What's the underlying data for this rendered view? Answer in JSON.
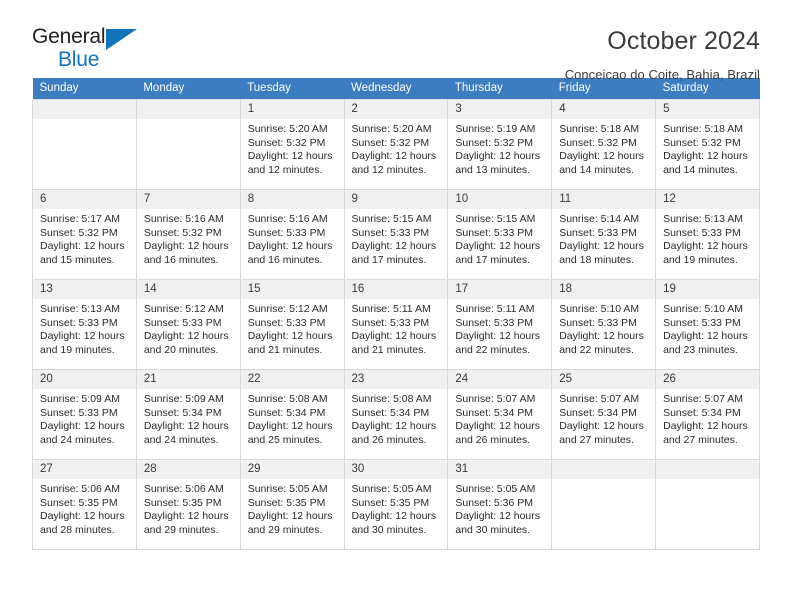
{
  "logo": {
    "word_top": "General",
    "word_bottom": "Blue",
    "accent_color": "#1173ba",
    "triangle_icon": "triangle-icon"
  },
  "header": {
    "title": "October 2024",
    "subtitle": "Conceicao do Coite, Bahia, Brazil"
  },
  "theme": {
    "header_row_bg": "#3b7dc0",
    "daynum_bg": "#f0f0f0",
    "grid_border": "#d8d8d8"
  },
  "calendar": {
    "weekday_headers": [
      "Sunday",
      "Monday",
      "Tuesday",
      "Wednesday",
      "Thursday",
      "Friday",
      "Saturday"
    ],
    "weeks": [
      [
        {
          "day": "",
          "lines": []
        },
        {
          "day": "",
          "lines": []
        },
        {
          "day": "1",
          "lines": [
            "Sunrise: 5:20 AM",
            "Sunset: 5:32 PM",
            "Daylight: 12 hours",
            "and 12 minutes."
          ]
        },
        {
          "day": "2",
          "lines": [
            "Sunrise: 5:20 AM",
            "Sunset: 5:32 PM",
            "Daylight: 12 hours",
            "and 12 minutes."
          ]
        },
        {
          "day": "3",
          "lines": [
            "Sunrise: 5:19 AM",
            "Sunset: 5:32 PM",
            "Daylight: 12 hours",
            "and 13 minutes."
          ]
        },
        {
          "day": "4",
          "lines": [
            "Sunrise: 5:18 AM",
            "Sunset: 5:32 PM",
            "Daylight: 12 hours",
            "and 14 minutes."
          ]
        },
        {
          "day": "5",
          "lines": [
            "Sunrise: 5:18 AM",
            "Sunset: 5:32 PM",
            "Daylight: 12 hours",
            "and 14 minutes."
          ]
        }
      ],
      [
        {
          "day": "6",
          "lines": [
            "Sunrise: 5:17 AM",
            "Sunset: 5:32 PM",
            "Daylight: 12 hours",
            "and 15 minutes."
          ]
        },
        {
          "day": "7",
          "lines": [
            "Sunrise: 5:16 AM",
            "Sunset: 5:32 PM",
            "Daylight: 12 hours",
            "and 16 minutes."
          ]
        },
        {
          "day": "8",
          "lines": [
            "Sunrise: 5:16 AM",
            "Sunset: 5:33 PM",
            "Daylight: 12 hours",
            "and 16 minutes."
          ]
        },
        {
          "day": "9",
          "lines": [
            "Sunrise: 5:15 AM",
            "Sunset: 5:33 PM",
            "Daylight: 12 hours",
            "and 17 minutes."
          ]
        },
        {
          "day": "10",
          "lines": [
            "Sunrise: 5:15 AM",
            "Sunset: 5:33 PM",
            "Daylight: 12 hours",
            "and 17 minutes."
          ]
        },
        {
          "day": "11",
          "lines": [
            "Sunrise: 5:14 AM",
            "Sunset: 5:33 PM",
            "Daylight: 12 hours",
            "and 18 minutes."
          ]
        },
        {
          "day": "12",
          "lines": [
            "Sunrise: 5:13 AM",
            "Sunset: 5:33 PM",
            "Daylight: 12 hours",
            "and 19 minutes."
          ]
        }
      ],
      [
        {
          "day": "13",
          "lines": [
            "Sunrise: 5:13 AM",
            "Sunset: 5:33 PM",
            "Daylight: 12 hours",
            "and 19 minutes."
          ]
        },
        {
          "day": "14",
          "lines": [
            "Sunrise: 5:12 AM",
            "Sunset: 5:33 PM",
            "Daylight: 12 hours",
            "and 20 minutes."
          ]
        },
        {
          "day": "15",
          "lines": [
            "Sunrise: 5:12 AM",
            "Sunset: 5:33 PM",
            "Daylight: 12 hours",
            "and 21 minutes."
          ]
        },
        {
          "day": "16",
          "lines": [
            "Sunrise: 5:11 AM",
            "Sunset: 5:33 PM",
            "Daylight: 12 hours",
            "and 21 minutes."
          ]
        },
        {
          "day": "17",
          "lines": [
            "Sunrise: 5:11 AM",
            "Sunset: 5:33 PM",
            "Daylight: 12 hours",
            "and 22 minutes."
          ]
        },
        {
          "day": "18",
          "lines": [
            "Sunrise: 5:10 AM",
            "Sunset: 5:33 PM",
            "Daylight: 12 hours",
            "and 22 minutes."
          ]
        },
        {
          "day": "19",
          "lines": [
            "Sunrise: 5:10 AM",
            "Sunset: 5:33 PM",
            "Daylight: 12 hours",
            "and 23 minutes."
          ]
        }
      ],
      [
        {
          "day": "20",
          "lines": [
            "Sunrise: 5:09 AM",
            "Sunset: 5:33 PM",
            "Daylight: 12 hours",
            "and 24 minutes."
          ]
        },
        {
          "day": "21",
          "lines": [
            "Sunrise: 5:09 AM",
            "Sunset: 5:34 PM",
            "Daylight: 12 hours",
            "and 24 minutes."
          ]
        },
        {
          "day": "22",
          "lines": [
            "Sunrise: 5:08 AM",
            "Sunset: 5:34 PM",
            "Daylight: 12 hours",
            "and 25 minutes."
          ]
        },
        {
          "day": "23",
          "lines": [
            "Sunrise: 5:08 AM",
            "Sunset: 5:34 PM",
            "Daylight: 12 hours",
            "and 26 minutes."
          ]
        },
        {
          "day": "24",
          "lines": [
            "Sunrise: 5:07 AM",
            "Sunset: 5:34 PM",
            "Daylight: 12 hours",
            "and 26 minutes."
          ]
        },
        {
          "day": "25",
          "lines": [
            "Sunrise: 5:07 AM",
            "Sunset: 5:34 PM",
            "Daylight: 12 hours",
            "and 27 minutes."
          ]
        },
        {
          "day": "26",
          "lines": [
            "Sunrise: 5:07 AM",
            "Sunset: 5:34 PM",
            "Daylight: 12 hours",
            "and 27 minutes."
          ]
        }
      ],
      [
        {
          "day": "27",
          "lines": [
            "Sunrise: 5:06 AM",
            "Sunset: 5:35 PM",
            "Daylight: 12 hours",
            "and 28 minutes."
          ]
        },
        {
          "day": "28",
          "lines": [
            "Sunrise: 5:06 AM",
            "Sunset: 5:35 PM",
            "Daylight: 12 hours",
            "and 29 minutes."
          ]
        },
        {
          "day": "29",
          "lines": [
            "Sunrise: 5:05 AM",
            "Sunset: 5:35 PM",
            "Daylight: 12 hours",
            "and 29 minutes."
          ]
        },
        {
          "day": "30",
          "lines": [
            "Sunrise: 5:05 AM",
            "Sunset: 5:35 PM",
            "Daylight: 12 hours",
            "and 30 minutes."
          ]
        },
        {
          "day": "31",
          "lines": [
            "Sunrise: 5:05 AM",
            "Sunset: 5:36 PM",
            "Daylight: 12 hours",
            "and 30 minutes."
          ]
        },
        {
          "day": "",
          "lines": []
        },
        {
          "day": "",
          "lines": []
        }
      ]
    ]
  }
}
